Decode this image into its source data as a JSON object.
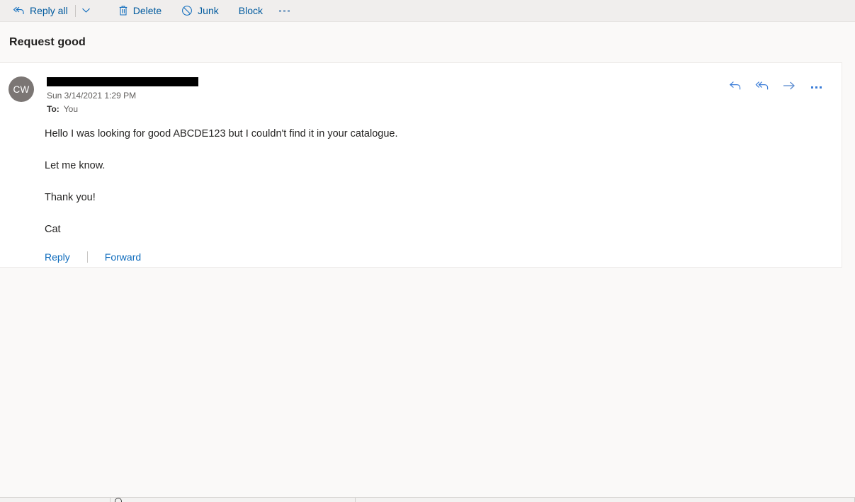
{
  "toolbar": {
    "reply_all": {
      "label": "Reply all",
      "icon": "reply-all-icon"
    },
    "caret": {
      "icon": "chevron-down-icon"
    },
    "delete": {
      "label": "Delete",
      "icon": "trash-icon"
    },
    "junk": {
      "label": "Junk",
      "icon": "block-circle-icon"
    },
    "block": {
      "label": "Block"
    },
    "more": {
      "icon": "more-horizontal-icon"
    }
  },
  "header": {
    "subject": "Request good"
  },
  "message": {
    "avatar_initials": "CW",
    "sender_redacted": true,
    "date": "Sun 3/14/2021 1:29 PM",
    "to_label": "To:",
    "to_value": "You",
    "actions": [
      {
        "name": "reply-icon",
        "title": "Reply"
      },
      {
        "name": "reply-all-icon",
        "title": "Reply all"
      },
      {
        "name": "forward-arrow-icon",
        "title": "Forward"
      },
      {
        "name": "more-horizontal-icon",
        "title": "More actions"
      }
    ],
    "body": [
      "Hello I was looking for good ABCDE123 but I couldn't find it in your catalogue.",
      "Let me know.",
      "Thank you!",
      "Cat"
    ],
    "footer": {
      "reply_label": "Reply",
      "forward_label": "Forward"
    }
  },
  "colors": {
    "toolbar_bg": "#f0eeed",
    "page_bg": "#faf9f8",
    "card_bg": "#ffffff",
    "link_blue": "#0f6cbd",
    "toolbar_link": "#005a9e",
    "avatar_bg": "#7b7674",
    "action_blue": "#3b7dd8",
    "text_primary": "#252423",
    "text_secondary": "#605e5c"
  }
}
